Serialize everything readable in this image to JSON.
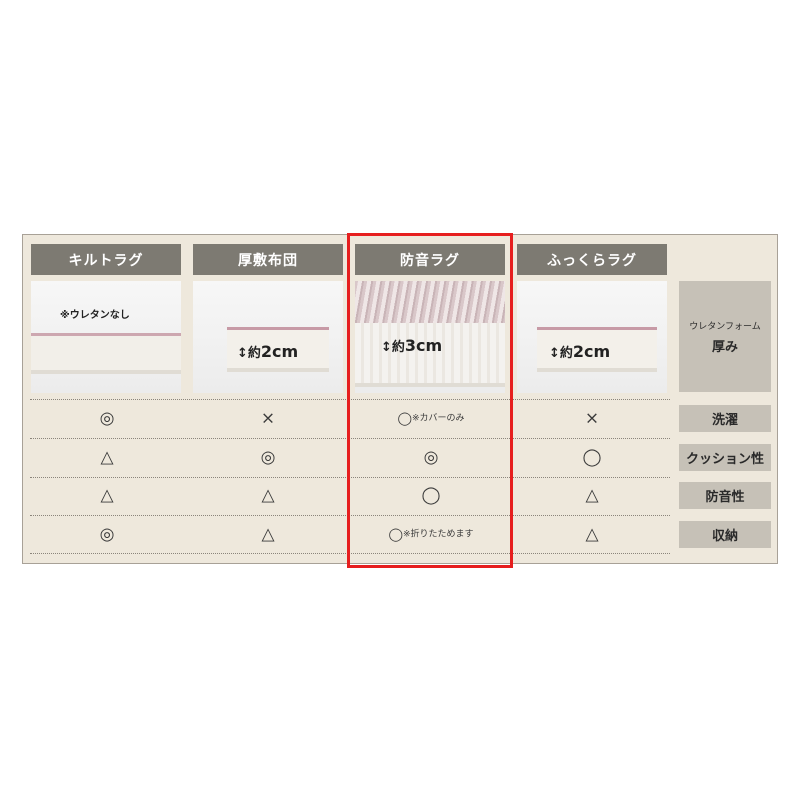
{
  "columns": [
    {
      "label": "キルトラグ",
      "note": "※ウレタンなし",
      "thickness_prefix": "",
      "thickness_value": ""
    },
    {
      "label": "厚敷布団",
      "note": "",
      "thickness_prefix": "約",
      "thickness_value": "2cm"
    },
    {
      "label": "防音ラグ",
      "note": "",
      "thickness_prefix": "約",
      "thickness_value": "3cm"
    },
    {
      "label": "ふっくらラグ",
      "note": "",
      "thickness_prefix": "約",
      "thickness_value": "2cm"
    }
  ],
  "side_header": {
    "line1": "ウレタンフォーム",
    "line2": "厚み"
  },
  "rows": [
    {
      "label": "洗濯",
      "cells": [
        "◎",
        "×",
        "◯",
        "×"
      ],
      "notes": [
        "",
        "",
        "※カバーのみ",
        ""
      ]
    },
    {
      "label": "クッション性",
      "cells": [
        "△",
        "◎",
        "◎",
        "◯"
      ],
      "notes": [
        "",
        "",
        "",
        ""
      ]
    },
    {
      "label": "防音性",
      "cells": [
        "△",
        "△",
        "◯",
        "△"
      ],
      "notes": [
        "",
        "",
        "",
        ""
      ]
    },
    {
      "label": "収納",
      "cells": [
        "◎",
        "△",
        "◯",
        "△"
      ],
      "notes": [
        "",
        "",
        "※折りたためます",
        ""
      ]
    }
  ],
  "colors": {
    "header_bg": "#7d7a72",
    "table_bg": "#eee8dc",
    "side_bg": "#c6c1b7",
    "highlight": "#e61e1e"
  }
}
